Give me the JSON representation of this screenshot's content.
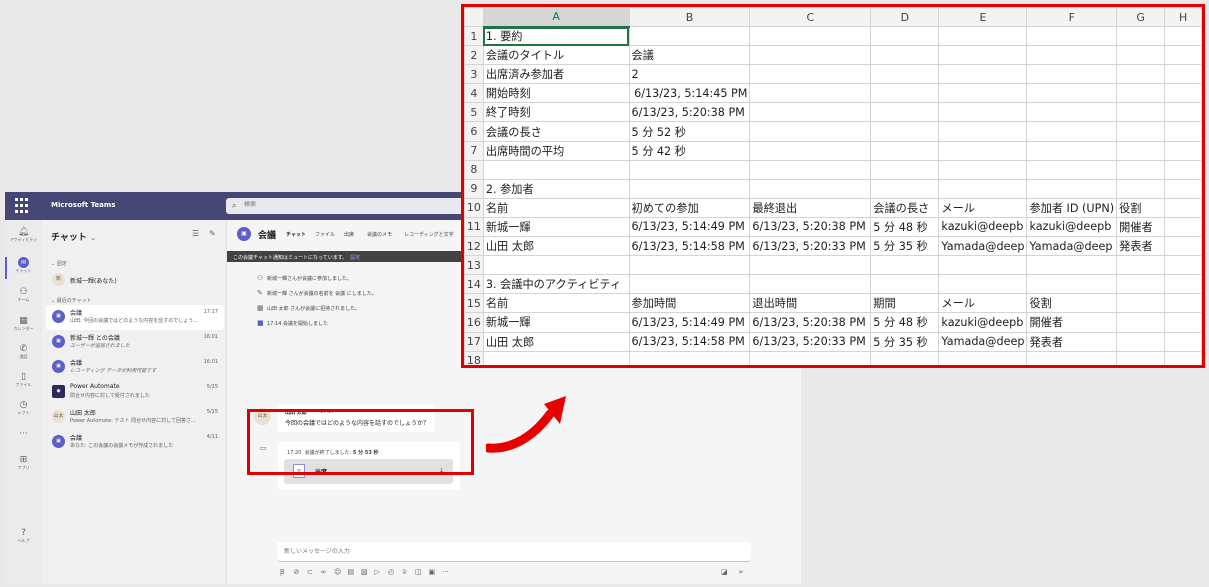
{
  "teams": {
    "app_title": "Microsoft Teams",
    "search_placeholder": "検索",
    "rail": [
      {
        "icon": "bell-icon",
        "label": "アクティビティ"
      },
      {
        "icon": "chat-icon",
        "label": "チャット"
      },
      {
        "icon": "teams-icon",
        "label": "チーム"
      },
      {
        "icon": "calendar-icon",
        "label": "カレンダー"
      },
      {
        "icon": "phone-icon",
        "label": "通話"
      },
      {
        "icon": "file-icon",
        "label": "ファイル"
      },
      {
        "icon": "shifts-icon",
        "label": "シフト"
      },
      {
        "icon": "more-icon",
        "label": ""
      },
      {
        "icon": "apps-icon",
        "label": "アプリ"
      },
      {
        "icon": "help-icon",
        "label": "ヘルプ"
      }
    ],
    "chat_list": {
      "title": "チャット",
      "chevron": "⌄",
      "pinned_label": "固定",
      "recent_label": "最近のチャット",
      "pinned": [
        {
          "name": "新城一輝(あなた)",
          "avatar": "新"
        }
      ],
      "recent": [
        {
          "name": "会議",
          "preview": "山田: 今回の会議ではどのような内容を話すのでしょう...",
          "time": "17:17",
          "active": true,
          "avatar": "▣"
        },
        {
          "name": "新城一輝 との会議",
          "preview": "ユーザーが追加されました",
          "time": "16:01",
          "italic": true,
          "avatar": "▣"
        },
        {
          "name": "会議",
          "preview": "レコーディング データが利用可能です",
          "time": "16:01",
          "italic": true,
          "avatar": "▣"
        },
        {
          "name": "Power Automate",
          "preview": "問合せ内容に対して受付されました",
          "time": "5/25",
          "avatar": "◆"
        },
        {
          "name": "山田 太郎",
          "preview": "Power Automate: テスト 問合せ内容に対して回答さ...",
          "time": "5/25",
          "avatar": "山太"
        },
        {
          "name": "会議",
          "preview": "あなた: この会議の会議メモが作成されました",
          "time": "4/11",
          "avatar": "▣"
        }
      ]
    },
    "chat": {
      "title": "会議",
      "tabs": [
        "チャット",
        "ファイル",
        "出席",
        "会議のメモ",
        "レコーディングと文字"
      ],
      "mute_banner": "この会議チャット通知はミュートになっています。",
      "mute_settings": "設定",
      "system_messages": [
        {
          "icon": "person-add-icon",
          "glyph": "⚇",
          "text": "新城一輝さんが会議に参加しました。"
        },
        {
          "icon": "pencil-icon",
          "glyph": "✎",
          "text": "新城一輝 さんが会議の名前を 会議 にしました。"
        },
        {
          "icon": "calendar-add-icon",
          "glyph": "▦",
          "text": "山田 太郎 さんが会議に招待されました。"
        },
        {
          "icon": "video-icon",
          "glyph": "■",
          "text": "17:14  会議を開始しました"
        }
      ],
      "message": {
        "avatar": "山太",
        "sender": "山田 太郎",
        "time": "17:17",
        "text": "今回の会議ではどのような内容を話すのでしょうか？"
      },
      "meeting_end": {
        "time": "17:20",
        "text_prefix": "会議が終了しました:",
        "duration": "5 分 53 秒",
        "attachment": "出席"
      },
      "compose_placeholder": "新しいメッセージの入力"
    }
  },
  "sheet": {
    "columns": [
      "A",
      "B",
      "C",
      "D",
      "E",
      "F",
      "G",
      "H"
    ],
    "rows": [
      [
        "1. 要約",
        "",
        "",
        "",
        "",
        "",
        "",
        ""
      ],
      [
        "会議のタイトル",
        "会議",
        "",
        "",
        "",
        "",
        "",
        ""
      ],
      [
        "出席済み参加者",
        "2",
        "",
        "",
        "",
        "",
        "",
        ""
      ],
      [
        "開始時刻",
        "6/13/23, 5:14:45 PM",
        "",
        "",
        "",
        "",
        "",
        ""
      ],
      [
        "終了時刻",
        "6/13/23, 5:20:38 PM",
        "",
        "",
        "",
        "",
        "",
        ""
      ],
      [
        "会議の長さ",
        "5 分 52 秒",
        "",
        "",
        "",
        "",
        "",
        ""
      ],
      [
        "出席時間の平均",
        "5 分 42 秒",
        "",
        "",
        "",
        "",
        "",
        ""
      ],
      [
        "",
        "",
        "",
        "",
        "",
        "",
        "",
        ""
      ],
      [
        "2. 参加者",
        "",
        "",
        "",
        "",
        "",
        "",
        ""
      ],
      [
        "名前",
        "初めての参加",
        "最終退出",
        "会議の長さ",
        "メール",
        "参加者 ID (UPN)",
        "役割",
        ""
      ],
      [
        "新城一輝",
        "6/13/23, 5:14:49 PM",
        "6/13/23, 5:20:38 PM",
        "5 分 48 秒",
        "kazuki@deepb",
        "kazuki@deepb",
        "開催者",
        ""
      ],
      [
        "山田 太郎",
        "6/13/23, 5:14:58 PM",
        "6/13/23, 5:20:33 PM",
        "5 分 35 秒",
        "Yamada@deep",
        "Yamada@deep",
        "発表者",
        ""
      ],
      [
        "",
        "",
        "",
        "",
        "",
        "",
        "",
        ""
      ],
      [
        "3. 会議中のアクティビティ",
        "",
        "",
        "",
        "",
        "",
        "",
        ""
      ],
      [
        "名前",
        "参加時間",
        "退出時間",
        "期間",
        "メール",
        "役割",
        "",
        ""
      ],
      [
        "新城一輝",
        "6/13/23, 5:14:49 PM",
        "6/13/23, 5:20:38 PM",
        "5 分 48 秒",
        "kazuki@deepb",
        "開催者",
        "",
        ""
      ],
      [
        "山田 太郎",
        "6/13/23, 5:14:58 PM",
        "6/13/23, 5:20:33 PM",
        "5 分 35 秒",
        "Yamada@deep",
        "発表者",
        "",
        ""
      ],
      [
        "",
        "",
        "",
        "",
        "",
        "",
        "",
        ""
      ]
    ],
    "numeric_cells": [
      "3,1"
    ],
    "selected_cell": "1,0"
  },
  "colors": {
    "teams_purple": "#464775",
    "brand": "#5b5fc7",
    "highlight_red": "#e00000",
    "excel_green": "#217346"
  }
}
